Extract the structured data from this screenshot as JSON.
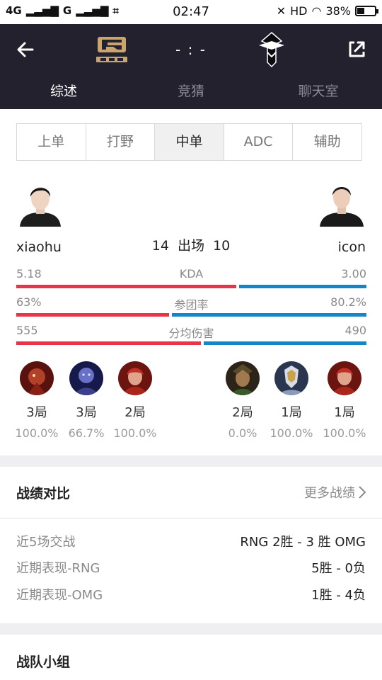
{
  "status_bar": {
    "network": "4G",
    "network2": "G",
    "time": "02:47",
    "hd": "HD",
    "battery": "38%",
    "battery_level": 0.38
  },
  "header": {
    "score": "- : -",
    "tabs": [
      {
        "label": "综述",
        "active": true
      },
      {
        "label": "竞猜",
        "active": false
      },
      {
        "label": "聊天室",
        "active": false
      }
    ]
  },
  "positions": [
    {
      "label": "上单",
      "active": false
    },
    {
      "label": "打野",
      "active": false
    },
    {
      "label": "中单",
      "active": true
    },
    {
      "label": "ADC",
      "active": false
    },
    {
      "label": "辅助",
      "active": false
    }
  ],
  "matchup": {
    "left_player": "xiaohu",
    "right_player": "icon",
    "left_games": "14",
    "games_label": "出场",
    "right_games": "10"
  },
  "stats": [
    {
      "label": "KDA",
      "left": "5.18",
      "right": "3.00",
      "left_share": 0.633
    },
    {
      "label": "参团率",
      "left": "63%",
      "right": "80.2%",
      "left_share": 0.44
    },
    {
      "label": "分均伤害",
      "left": "555",
      "right": "490",
      "left_share": 0.531
    }
  ],
  "champions": {
    "left": [
      {
        "icon": "champion-red-portrait",
        "count": "3局",
        "rate": "100.0%"
      },
      {
        "icon": "champion-blue-portrait",
        "count": "3局",
        "rate": "66.7%"
      },
      {
        "icon": "champion-crimson-portrait",
        "count": "2局",
        "rate": "100.0%"
      }
    ],
    "right": [
      {
        "icon": "champion-dark-portrait",
        "count": "2局",
        "rate": "0.0%"
      },
      {
        "icon": "champion-gold-portrait",
        "count": "1局",
        "rate": "100.0%"
      },
      {
        "icon": "champion-crimson-portrait",
        "count": "1局",
        "rate": "100.0%"
      }
    ]
  },
  "records": {
    "title": "战绩对比",
    "more": "更多战绩",
    "rows": [
      {
        "key": "近5场交战",
        "value": "RNG 2胜 - 3 胜 OMG"
      },
      {
        "key": "近期表现-RNG",
        "value": "5胜 - 0负"
      },
      {
        "key": "近期表现-OMG",
        "value": "1胜 - 4负"
      }
    ]
  },
  "team_section": {
    "title": "战队小组"
  },
  "colors": {
    "header_bg": "#23212d",
    "left_team": "#e8344a",
    "right_team": "#1286c8"
  }
}
